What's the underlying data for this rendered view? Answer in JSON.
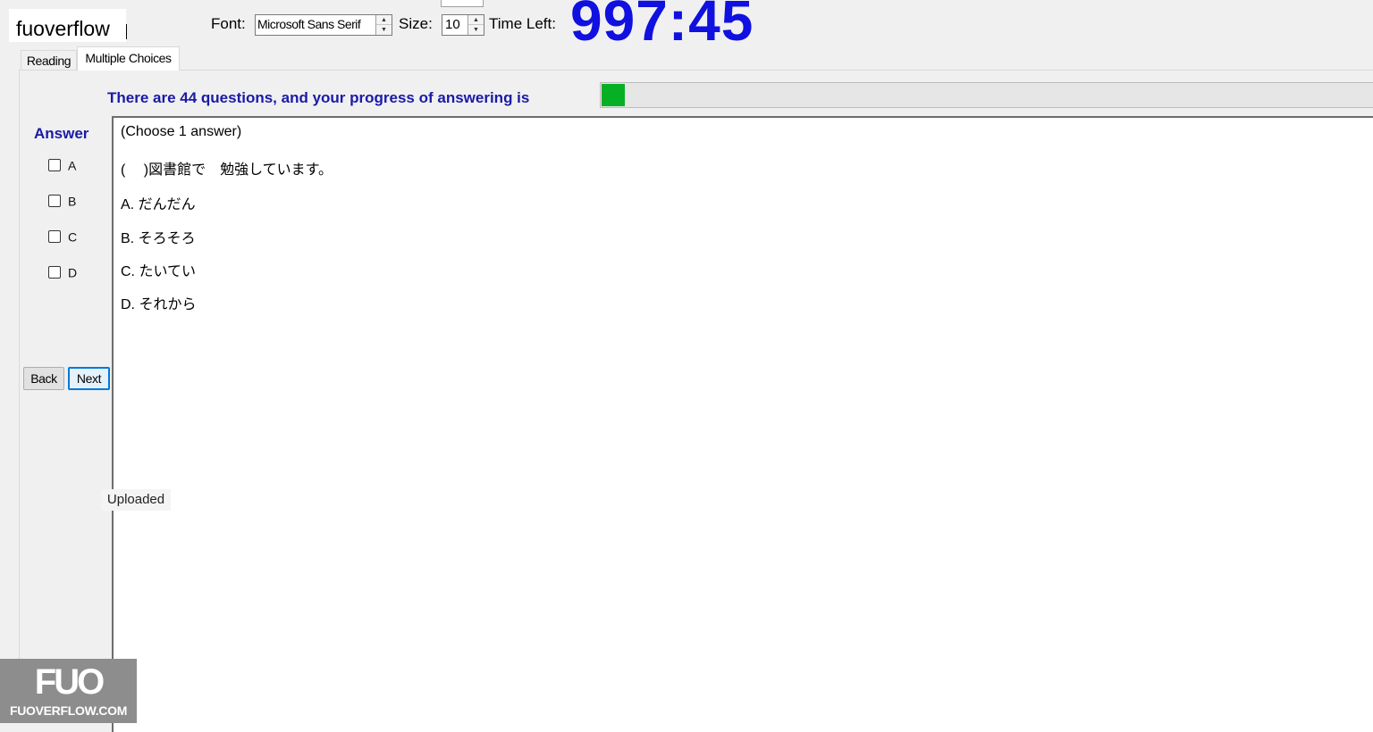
{
  "watermark": {
    "label": "fuoverflow"
  },
  "toolbar": {
    "font_label": "Font:",
    "font_value": "Microsoft Sans Serif",
    "size_label": "Size:",
    "size_value": "10",
    "time_label": "Time Left:",
    "time_value": "997:45"
  },
  "tabs": [
    {
      "label": "Reading",
      "active": false
    },
    {
      "label": "Multiple Choices",
      "active": true
    }
  ],
  "progress": {
    "label": "There are 44 questions, and your progress of answering is",
    "fraction": 0.03,
    "fill_color": "#06b025"
  },
  "answer": {
    "title": "Answer",
    "options": [
      "A",
      "B",
      "C",
      "D"
    ]
  },
  "navigation": {
    "back_label": "Back",
    "next_label": "Next"
  },
  "question": {
    "instruction": "(Choose 1 answer)",
    "stem": "(　 )図書館で　勉強しています。",
    "choices": [
      "A. だんだん",
      "B. そろそろ",
      "C. たいてい",
      "D. それから"
    ]
  },
  "status": {
    "uploaded": "Uploaded"
  },
  "logo": {
    "mark": "FUO",
    "text": "FUOVERFLOW.COM"
  },
  "colors": {
    "accent_blue": "#1a1aa8",
    "timer_blue": "#1010e0"
  }
}
